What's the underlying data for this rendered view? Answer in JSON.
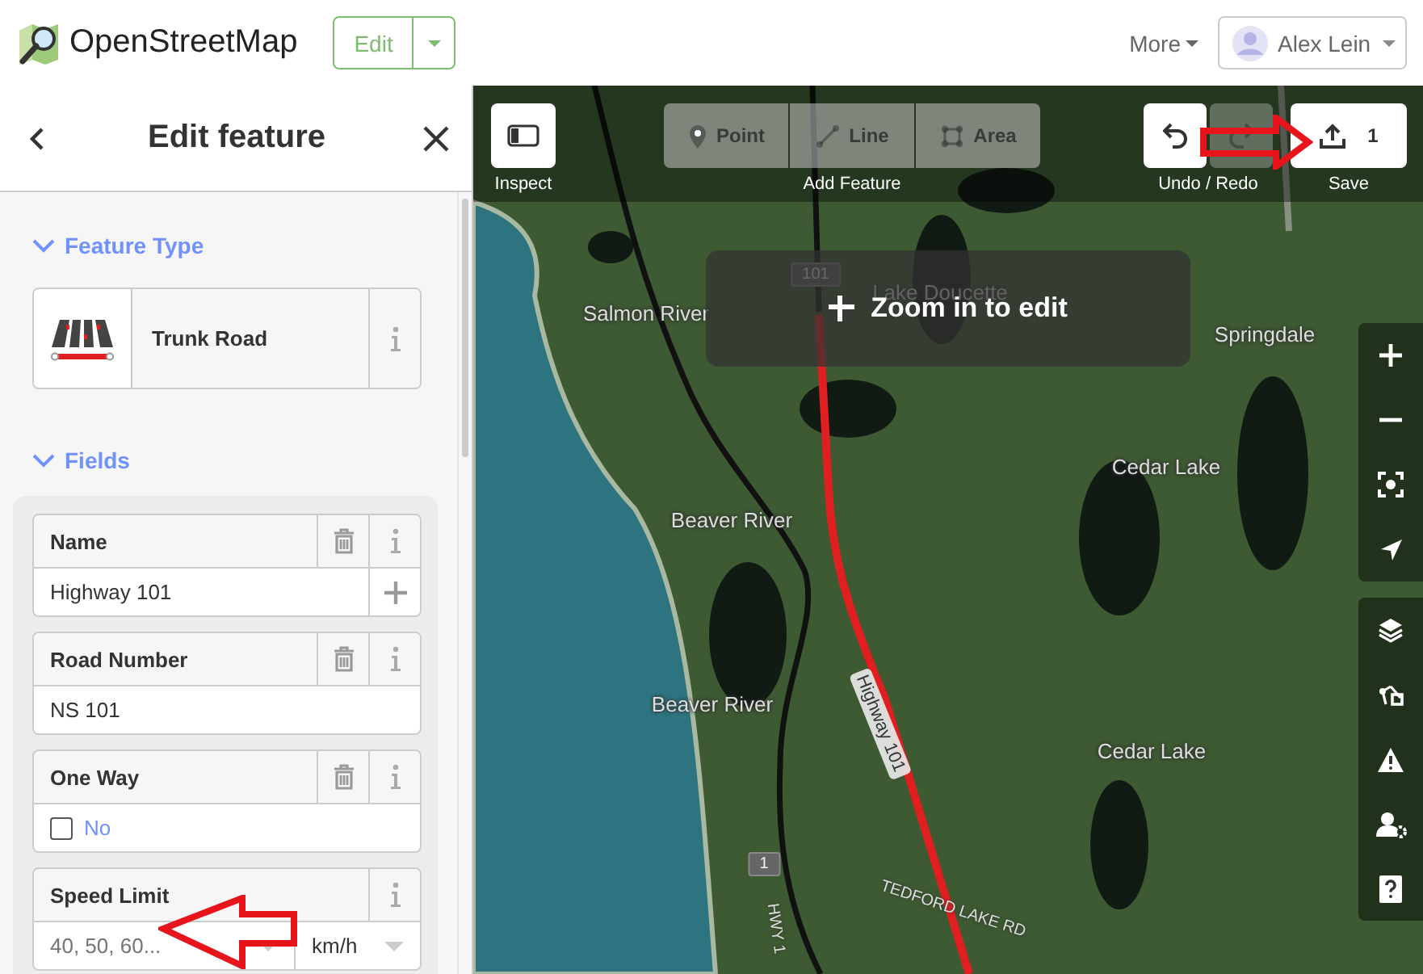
{
  "top_bar": {
    "logo_text": "OpenStreetMap",
    "edit_button": "Edit",
    "more_menu": "More",
    "user": "Alex Lein"
  },
  "sidebar": {
    "title": "Edit feature",
    "feature_type": {
      "heading": "Feature Type",
      "expanded": true,
      "preset": "Trunk Road"
    },
    "fields_section": {
      "heading": "Fields",
      "expanded": true,
      "fields": [
        {
          "kind": "text",
          "label": "Name",
          "value": "Highway 101",
          "removable": true,
          "localized": true
        },
        {
          "kind": "text",
          "label": "Road Number",
          "value": "NS 101",
          "removable": true,
          "localized": false
        },
        {
          "kind": "check",
          "label": "One Way",
          "checked": false,
          "value": "No",
          "removable": true
        },
        {
          "kind": "combo",
          "label": "Speed Limit",
          "placeholder": "40, 50, 60...",
          "unit": "km/h",
          "removable": false
        }
      ]
    }
  },
  "map": {
    "toolbar": {
      "inspect": {
        "label": "Inspect"
      },
      "add_feature": {
        "label": "Add Feature",
        "modes": [
          {
            "kind": "point",
            "label": "Point",
            "disabled": true
          },
          {
            "kind": "line",
            "label": "Line",
            "disabled": true
          },
          {
            "kind": "area",
            "label": "Area",
            "disabled": true
          }
        ]
      },
      "history": {
        "label": "Undo / Redo",
        "buttons": [
          {
            "kind": "undo",
            "disabled": false
          },
          {
            "kind": "redo",
            "disabled": true
          }
        ]
      },
      "save": {
        "label": "Save",
        "count": "1"
      }
    },
    "notice": "Zoom in to edit",
    "labels": [
      {
        "kind": "place",
        "text": "Salmon River"
      },
      {
        "kind": "place",
        "text": "Lake Doucette"
      },
      {
        "kind": "place",
        "text": "Springdale"
      },
      {
        "kind": "place",
        "text": "Cedar Lake"
      },
      {
        "kind": "place",
        "text": "Beaver River"
      },
      {
        "kind": "place",
        "text": "Beaver River"
      },
      {
        "kind": "place",
        "text": "Cedar Lake"
      },
      {
        "kind": "road",
        "text": "Highway 101"
      },
      {
        "kind": "minor_road",
        "text": "TEDFORD LAKE RD"
      },
      {
        "kind": "minor_road",
        "text": "HWY 1"
      },
      {
        "kind": "shield",
        "text": "101"
      },
      {
        "kind": "shield",
        "text": "1"
      }
    ]
  }
}
